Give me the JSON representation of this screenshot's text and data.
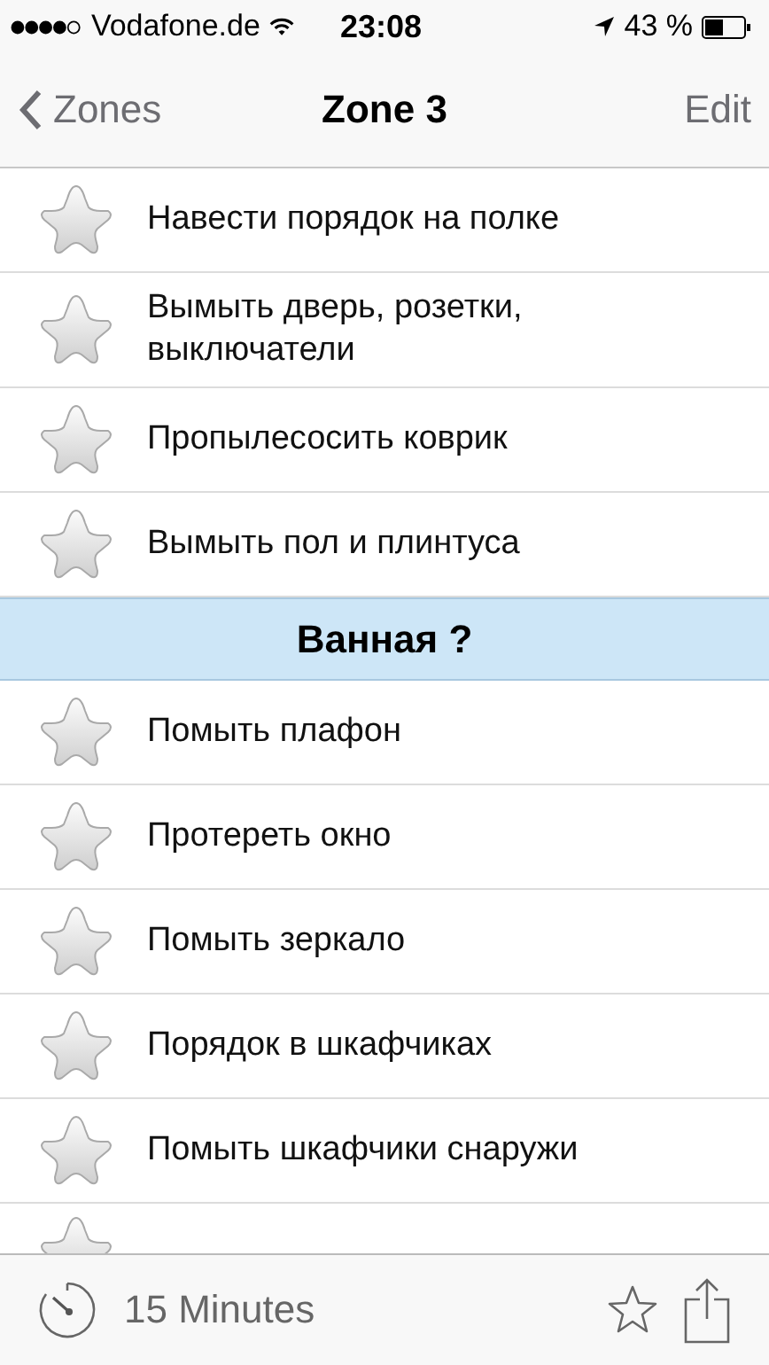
{
  "status_bar": {
    "carrier": "Vodafone.de",
    "time": "23:08",
    "battery": "43 %"
  },
  "nav": {
    "back": "Zones",
    "title": "Zone 3",
    "action": "Edit"
  },
  "sections": [
    {
      "items": [
        {
          "label": "Навести порядок на полке"
        },
        {
          "label": "Вымыть дверь, розетки, выключатели"
        },
        {
          "label": "Пропылесосить коврик"
        },
        {
          "label": "Вымыть пол и плинтуса"
        }
      ]
    },
    {
      "title": "Ванная ?",
      "items": [
        {
          "label": "Помыть плафон"
        },
        {
          "label": "Протереть окно"
        },
        {
          "label": "Помыть зеркало"
        },
        {
          "label": "Порядок в шкафчиках"
        },
        {
          "label": "Помыть шкафчики снаружи"
        }
      ]
    }
  ],
  "toolbar": {
    "duration": "15 Minutes"
  }
}
